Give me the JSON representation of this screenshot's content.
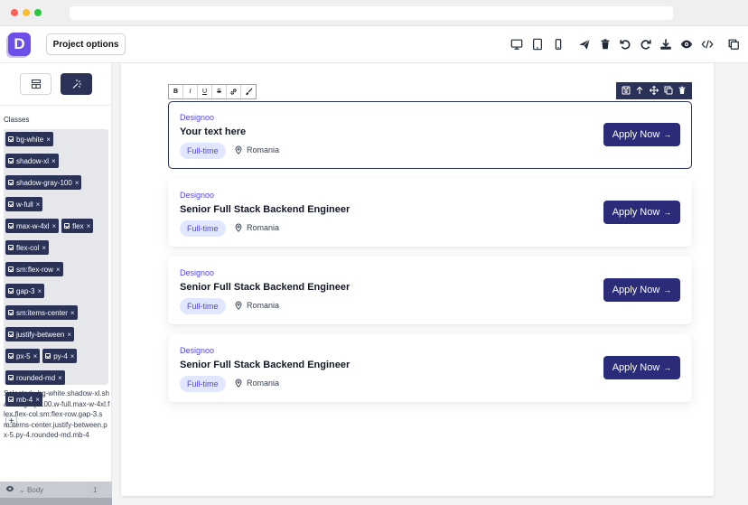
{
  "app": {
    "logo_letter": "D",
    "project_options_label": "Project options",
    "accent_color": "#2a3257",
    "brand_color": "#6d4ee8"
  },
  "toolbar_icons": [
    "desktop-icon",
    "tablet-icon",
    "mobile-icon",
    "send-icon",
    "trash-icon",
    "undo-icon",
    "redo-icon",
    "download-icon",
    "eye-icon",
    "code-icon",
    "copy-icon"
  ],
  "left_panel": {
    "tabs": [
      "layout-icon",
      "magic-wand-icon"
    ],
    "classes_title": "Classes",
    "chips": [
      "bg-white",
      "shadow-xl",
      "shadow-gray-100",
      "w-full",
      "max-w-4xl",
      "flex",
      "flex-col",
      "sm:flex-row",
      "gap-3",
      "sm:items-center",
      "justify-between",
      "px-5",
      "py-4",
      "rounded-md",
      "mb-4"
    ],
    "add_label": "+",
    "selected_text": "Selected:  .bg-white.shadow-xl.shadow-gray-100.w-full.max-w-4xl.flex.flex-col.sm:flex-row.gap-3.sm:items-center.justify-between.px-5.py-4.rounded-md.mb-4",
    "layer": {
      "label": "Body",
      "count": "1"
    }
  },
  "format_toolbar": [
    "B",
    "I",
    "U",
    "S",
    "link-icon",
    "brush-icon"
  ],
  "component_toolbar": [
    "save-icon",
    "arrow-up-icon",
    "move-icon",
    "clone-icon",
    "delete-icon"
  ],
  "cards": [
    {
      "company": "Designoo",
      "title": "Your text here",
      "badge": "Full-time",
      "location": "Romania",
      "apply": "Apply Now",
      "selected": true
    },
    {
      "company": "Designoo",
      "title": "Senior Full Stack Backend Engineer",
      "badge": "Full-time",
      "location": "Romania",
      "apply": "Apply Now",
      "selected": false
    },
    {
      "company": "Designoo",
      "title": "Senior Full Stack Backend Engineer",
      "badge": "Full-time",
      "location": "Romania",
      "apply": "Apply Now",
      "selected": false
    },
    {
      "company": "Designoo",
      "title": "Senior Full Stack Backend Engineer",
      "badge": "Full-time",
      "location": "Romania",
      "apply": "Apply Now",
      "selected": false
    }
  ]
}
